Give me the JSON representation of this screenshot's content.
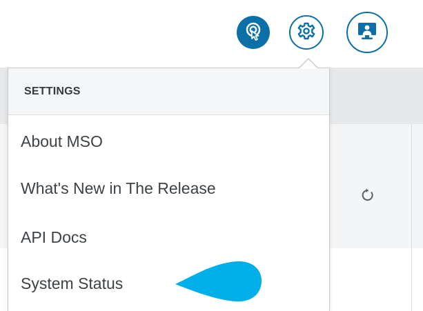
{
  "toolbar": {
    "help_icon": "help-pointer-icon",
    "settings_icon": "gear-icon",
    "display_icon": "monitor-user-icon"
  },
  "settings_menu": {
    "header": "SETTINGS",
    "items": [
      {
        "label": "About MSO"
      },
      {
        "label": "What's New in The Release"
      },
      {
        "label": "API Docs"
      },
      {
        "label": "System Status"
      }
    ]
  },
  "background": {
    "refresh_icon": "refresh-icon"
  },
  "colors": {
    "accent": "#0b6fa8",
    "callout": "#00aee8",
    "menu_text": "#3c4246"
  }
}
